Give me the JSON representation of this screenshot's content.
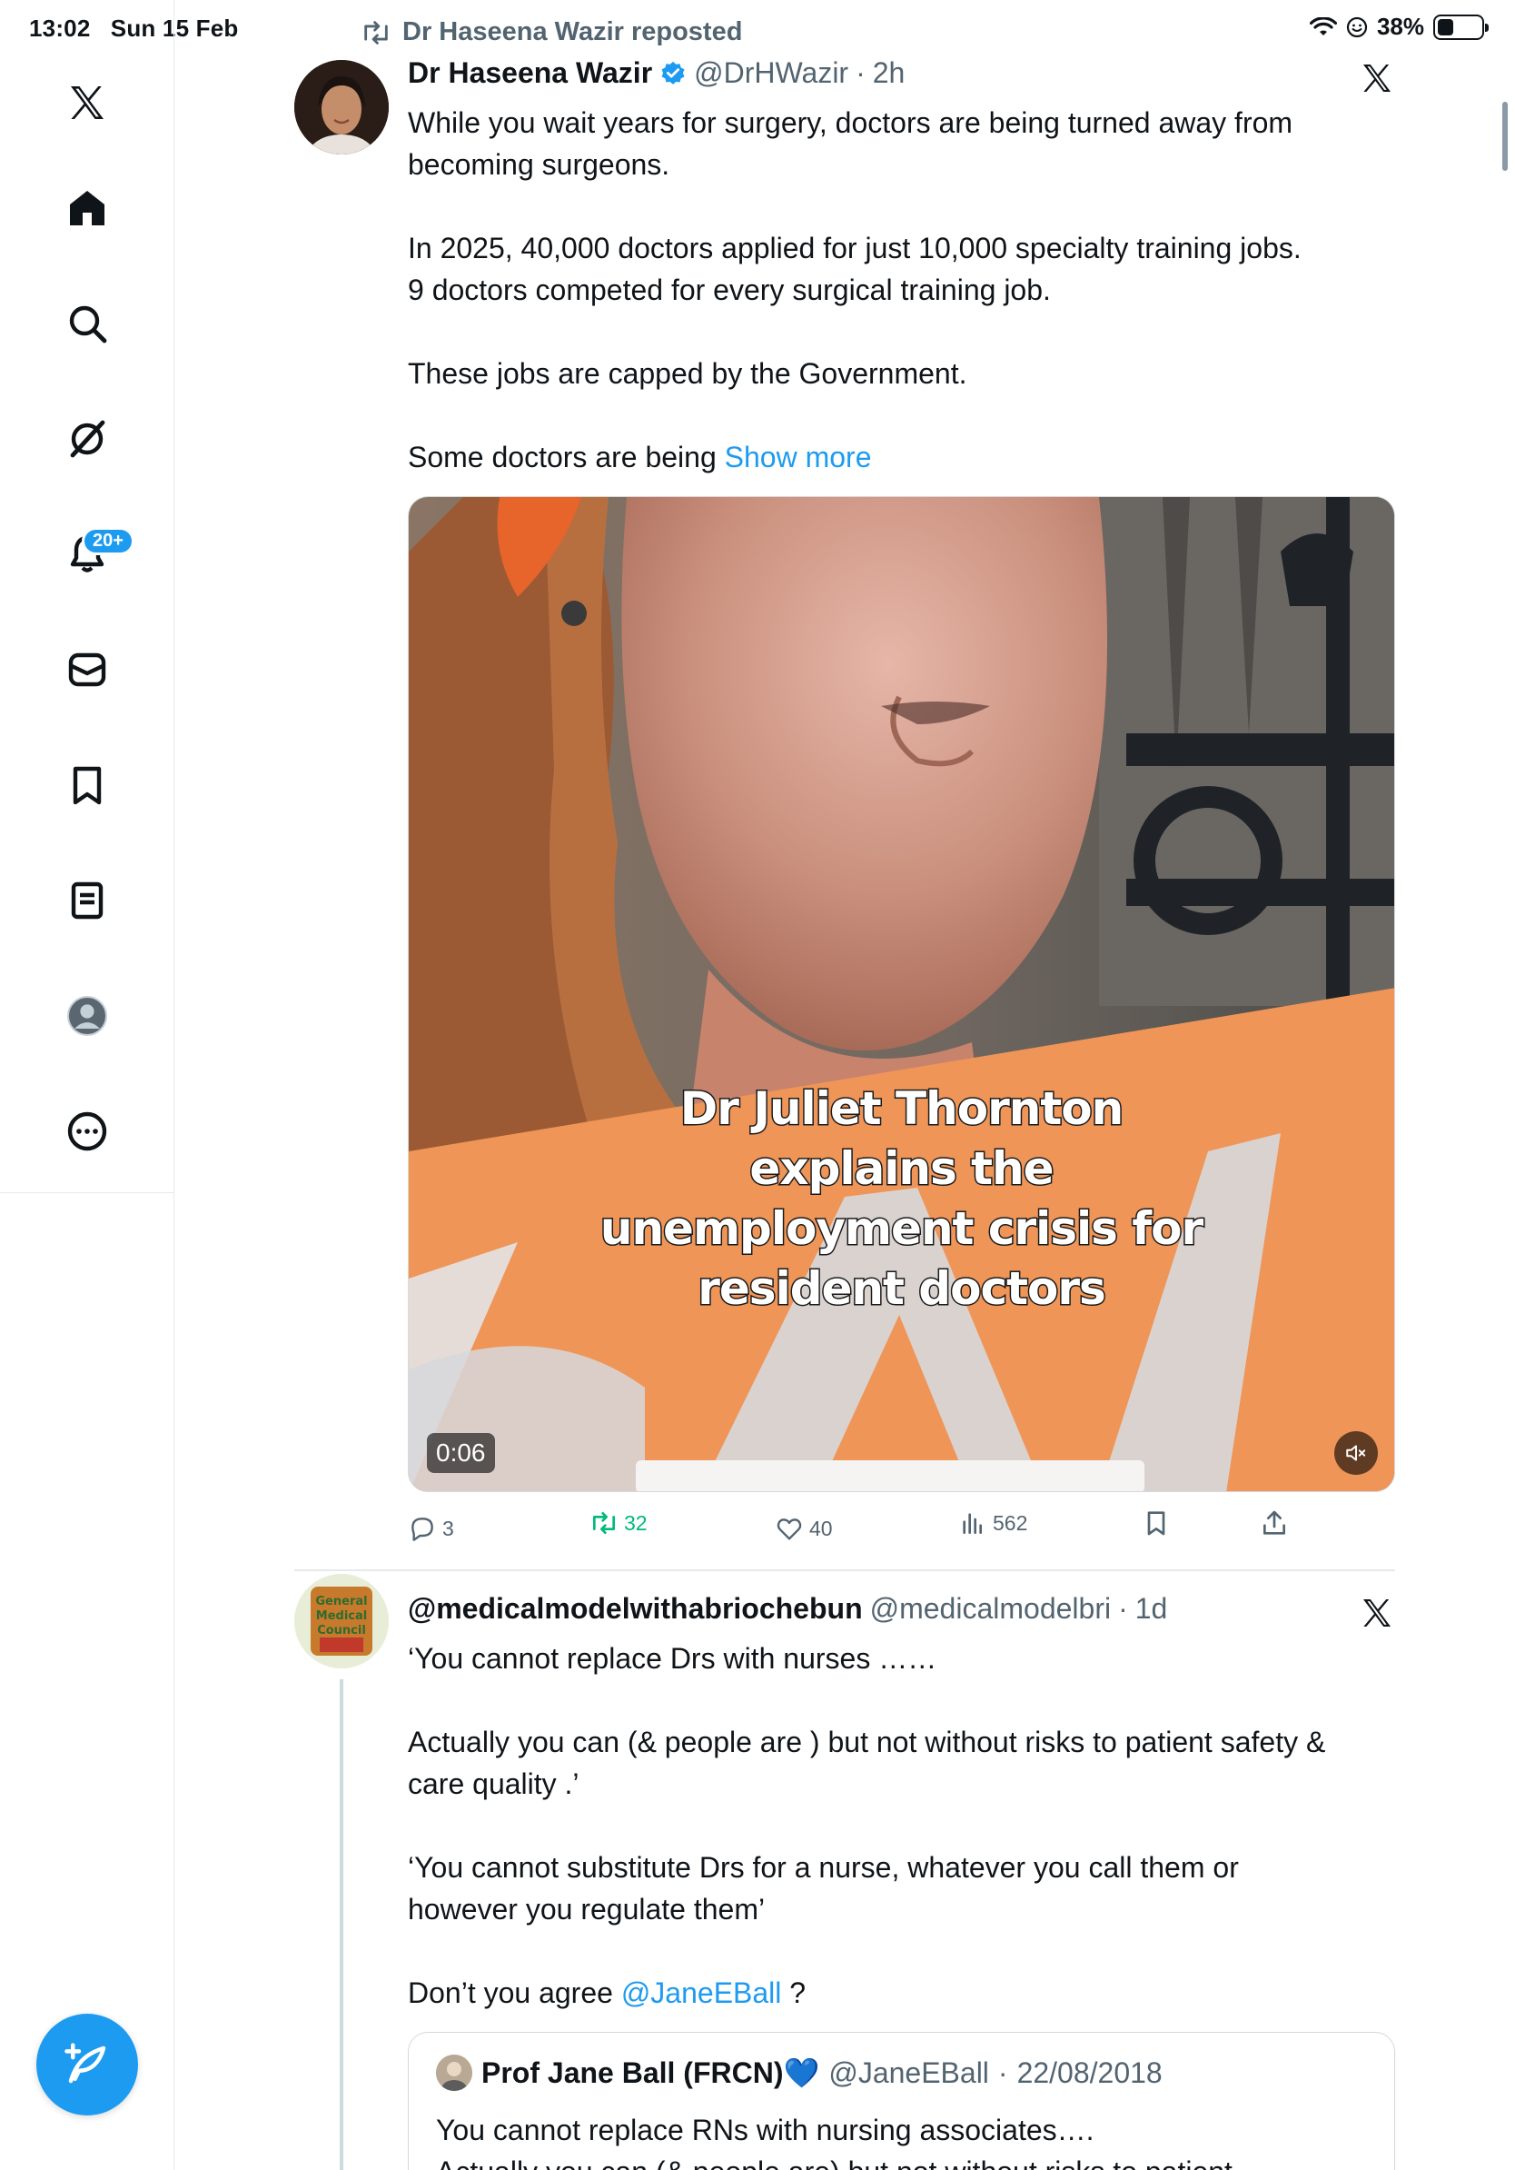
{
  "status_bar": {
    "time": "13:02",
    "date": "Sun 15 Feb",
    "battery": "38%",
    "battery_level": 0.38
  },
  "sidebar": {
    "items": [
      {
        "name": "x-logo-icon"
      },
      {
        "name": "home-icon"
      },
      {
        "name": "search-icon"
      },
      {
        "name": "grok-icon"
      },
      {
        "name": "notifications-icon"
      },
      {
        "name": "messages-icon"
      },
      {
        "name": "bookmarks-icon"
      },
      {
        "name": "lists-icon"
      },
      {
        "name": "profile-icon"
      },
      {
        "name": "more-icon"
      }
    ],
    "notifications_badge": "20+",
    "compose_icon": "compose-plus-icon"
  },
  "tweet1": {
    "repost_label": "Dr Haseena Wazir reposted",
    "author_name": "Dr Haseena Wazir",
    "verified": true,
    "handle": "@DrHWazir",
    "dot": "·",
    "time": "2h",
    "text_lines": [
      "While you wait years for surgery, doctors are being turned away from",
      "becoming surgeons.",
      "In 2025, 40,000 doctors applied for just 10,000 specialty training jobs.",
      "9 doctors competed for every surgical training job.",
      "These jobs are capped by the Government.",
      "Some doctors are being"
    ],
    "show_more": "Show more",
    "video": {
      "caption_lines": [
        "Dr Juliet Thornton",
        "explains the",
        "unemployment crisis for",
        "resident doctors"
      ],
      "duration": "0:06",
      "muted": true
    },
    "actions": {
      "replies": "3",
      "reposts": "32",
      "likes": "40",
      "views": "562"
    }
  },
  "tweet2": {
    "author_name": "@medicalmodelwithabriochebun",
    "handle": "@medicalmodelbri",
    "dot": "·",
    "time": "1d",
    "avatar_text": "General Medical Council",
    "text_lines": [
      "‘You cannot replace Drs with nurses ……",
      "Actually you can (& people are ) but not without risks to patient safety &",
      "care quality .’",
      "‘You cannot substitute Drs for a nurse, whatever you call them or",
      "however you regulate them’",
      "Don’t you agree"
    ],
    "mention": "@JaneEBall",
    "mention_suffix": " ?",
    "quote": {
      "author_name": "Prof Jane Ball (FRCN)💙",
      "handle": "@JaneEBall",
      "dot": "·",
      "date": "22/08/2018",
      "text_lines": [
        "You cannot replace RNs with nursing associates….",
        "Actually you can (& people are) but not without risks to patient"
      ]
    }
  },
  "colors": {
    "accent": "#1d9bf0",
    "repost_green": "#00ba7c",
    "muted_text": "#536471",
    "border": "#e6e9eb"
  }
}
